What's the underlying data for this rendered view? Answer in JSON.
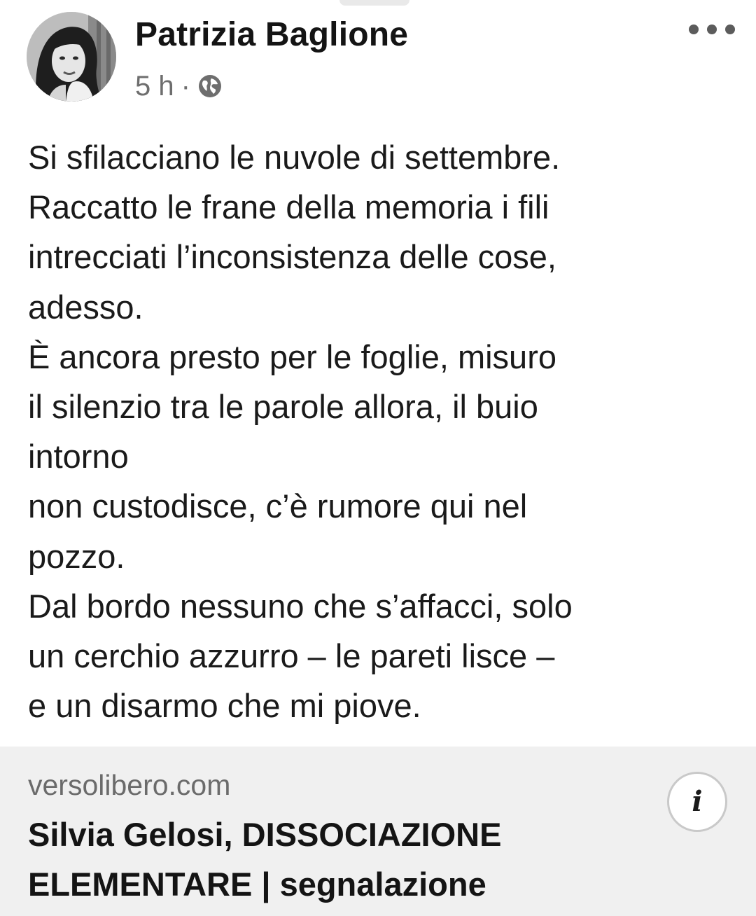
{
  "post": {
    "author": "Patrizia Baglione",
    "timestamp": "5 h",
    "separator": "·",
    "privacy_icon": "globe-icon",
    "more_icon": "more-horizontal-icon",
    "body_lines": [
      "Si sfilacciano le nuvole di settembre.",
      "Raccatto le frane della memoria i fili",
      "intrecciati l’inconsistenza delle cose,",
      "adesso.",
      "È ancora presto per le foglie, misuro",
      "il silenzio tra le parole allora, il buio",
      "intorno",
      "non custodisce, c’è rumore qui nel",
      "pozzo.",
      "Dal bordo nessuno che s’affacci, solo",
      "un cerchio azzurro – le pareti lisce –",
      "e un disarmo che mi piove."
    ]
  },
  "link_preview": {
    "domain": "versolibero.com",
    "title_lines": [
      "Silvia Gelosi, DISSOCIAZIONE",
      "ELEMENTARE | segnalazione"
    ],
    "info_label": "i",
    "info_icon": "info-icon"
  },
  "colors": {
    "card_background": "#f0f0f0",
    "meta_text": "#6e6e6e",
    "primary_text": "#141414"
  }
}
